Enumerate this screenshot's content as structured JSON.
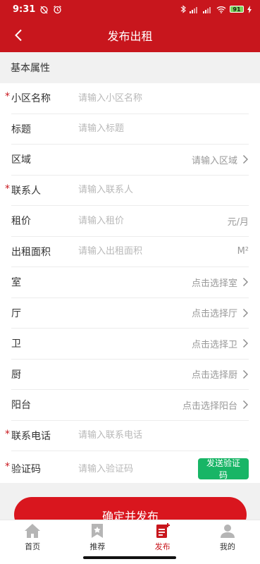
{
  "status_bar": {
    "time": "9:31",
    "battery": "91"
  },
  "header": {
    "title": "发布出租"
  },
  "section": {
    "title": "基本属性"
  },
  "fields": {
    "community": {
      "label": "小区名称",
      "placeholder": "请输入小区名称",
      "required": true
    },
    "title": {
      "label": "标题",
      "placeholder": "请输入标题"
    },
    "region": {
      "label": "区域",
      "value": "请输入区域"
    },
    "contact": {
      "label": "联系人",
      "placeholder": "请输入联系人",
      "required": true
    },
    "rent": {
      "label": "租价",
      "placeholder": "请输入租价",
      "unit": "元/月"
    },
    "area": {
      "label": "出租面积",
      "placeholder": "请输入出租面积",
      "unit": "M²"
    },
    "room": {
      "label": "室",
      "value": "点击选择室"
    },
    "hall": {
      "label": "厅",
      "value": "点击选择厅"
    },
    "bath": {
      "label": "卫",
      "value": "点击选择卫"
    },
    "kitchen": {
      "label": "厨",
      "value": "点击选择厨"
    },
    "balcony": {
      "label": "阳台",
      "value": "点击选择阳台"
    },
    "phone": {
      "label": "联系电话",
      "placeholder": "请输入联系电话",
      "required": true
    },
    "code": {
      "label": "验证码",
      "placeholder": "请输入验证码",
      "button": "发送验证码",
      "required": true
    }
  },
  "submit": {
    "label": "确定并发布"
  },
  "tabbar": {
    "items": [
      {
        "label": "首页",
        "icon": "home-icon"
      },
      {
        "label": "推荐",
        "icon": "bookmark-star-icon"
      },
      {
        "label": "发布",
        "icon": "publish-icon",
        "active": true
      },
      {
        "label": "我的",
        "icon": "user-icon"
      }
    ]
  },
  "colors": {
    "brand": "#c8161d",
    "send_code": "#18b566"
  }
}
